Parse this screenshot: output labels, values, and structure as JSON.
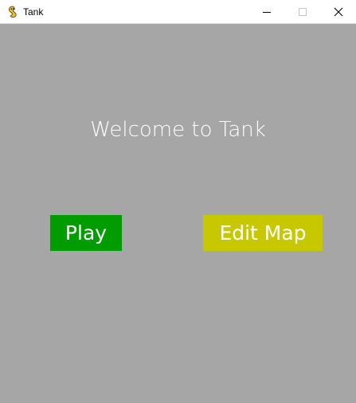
{
  "window": {
    "title": "Tank",
    "icon": "pygame-snake-icon",
    "controls": {
      "minimize_icon": "minimize-icon",
      "maximize_icon": "maximize-icon",
      "close_icon": "close-icon"
    }
  },
  "menu": {
    "welcome": "Welcome to Tank",
    "play_label": "Play",
    "edit_label": "Edit Map"
  },
  "colors": {
    "background": "#a6a6a6",
    "play_button": "#009c00",
    "edit_button": "#c8c800",
    "text": "#ffffff"
  }
}
